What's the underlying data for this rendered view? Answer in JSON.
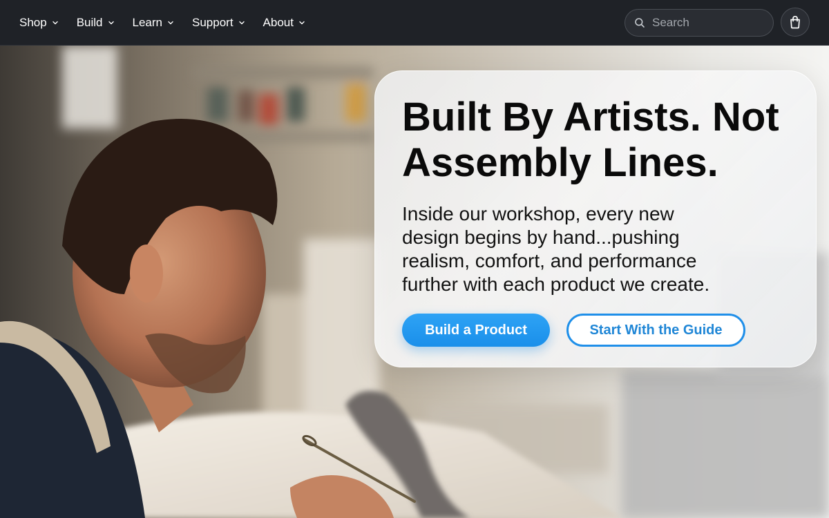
{
  "nav": {
    "items": [
      {
        "label": "Shop"
      },
      {
        "label": "Build"
      },
      {
        "label": "Learn"
      },
      {
        "label": "Support"
      },
      {
        "label": "About"
      }
    ],
    "search_placeholder": "Search"
  },
  "hero": {
    "title": "Built By Artists. Not Assembly Lines.",
    "description": "Inside our workshop, every new design begins by hand...pushing realism, comfort, and performance further with each product we create.",
    "primary_button": "Build a Product",
    "secondary_button": "Start With the Guide"
  },
  "icons": {
    "chevron": "chevron-down-icon",
    "search": "search-icon",
    "bag": "shopping-bag-icon"
  },
  "colors": {
    "nav_bg": "#1f2227",
    "accent": "#1f8fe9",
    "card_bg": "#f0f0f0"
  }
}
